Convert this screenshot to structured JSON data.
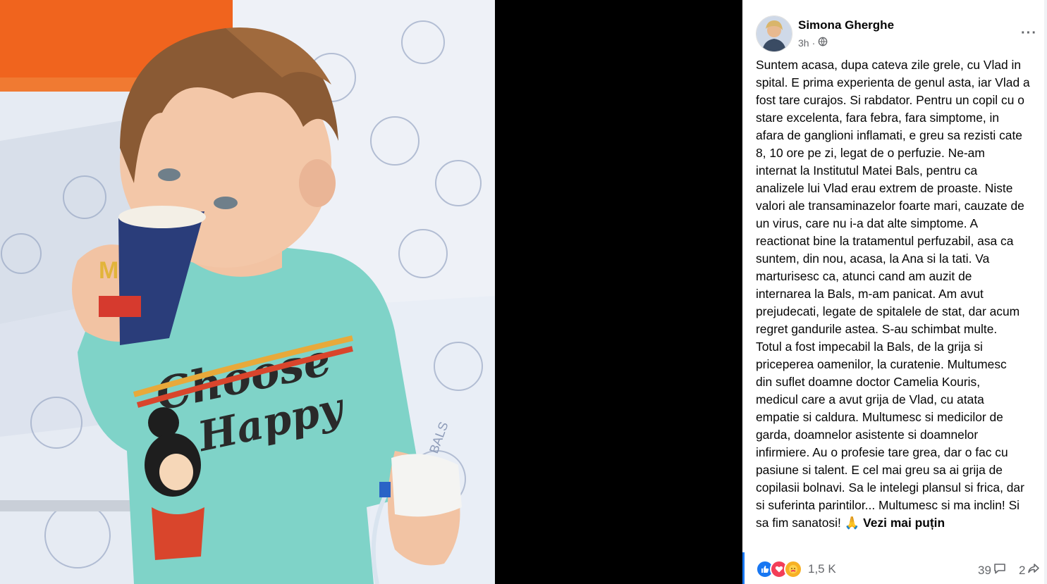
{
  "post": {
    "author": "Simona Gherghe",
    "time": "3h",
    "privacy_icon": "globe-icon",
    "more_label": "···",
    "lines": [
      "Suntem acasa, dupa cateva zile grele, cu Vlad in",
      "spital. E prima experienta de genul asta, iar Vlad a",
      "fost tare curajos. Si rabdator. Pentru un copil cu o",
      "stare excelenta, fara febra, fara simptome, in",
      "afara de ganglioni inflamati, e greu sa rezisti cate",
      "8, 10 ore pe zi, legat de o perfuzie. Ne-am",
      "internat la Institutul Matei Bals, pentru ca",
      "analizele lui Vlad erau extrem de proaste. Niste",
      "valori ale transaminazelor foarte mari, cauzate de",
      "un virus, care nu i-a dat alte simptome. A",
      "reactionat bine la tratamentul perfuzabil, asa ca",
      "suntem, din nou, acasa, la Ana si la tati. Va",
      "marturisesc ca, atunci cand am auzit de",
      "internarea la Bals, m-am panicat. Am avut",
      "prejudecati, legate de spitalele de stat, dar acum",
      "regret gandurile astea. S-au schimbat multe.",
      "Totul a fost impecabil la Bals, de la grija si",
      "priceperea oamenilor, la curatenie. Multumesc",
      "din suflet doamne doctor Camelia Kouris,",
      "medicul care a avut grija de Vlad, cu atata",
      "empatie si caldura. Multumesc si medicilor de",
      "garda, doamnelor asistente si doamnelor",
      "infirmiere. Au o profesie tare grea, dar o fac cu",
      "pasiune si talent. E cel mai greu sa ai grija de",
      "copilasii bolnavi. Sa le intelegi plansul si frica, dar",
      "si suferinta parintilor... Multumesc si ma inclin! Si"
    ],
    "last_line": "sa fim sanatosi! ",
    "emoji": "🙏",
    "see_less": "Vezi mai puțin",
    "reaction_count": "1,5 K",
    "comment_count": "39",
    "share_count": "2",
    "colors": {
      "accent": "#1877f2",
      "muted": "#65676b",
      "text": "#050505"
    }
  },
  "photo": {
    "shirt_text_1": "Choose",
    "shirt_text_2": "Happy",
    "pillow_text": "MATEI BALS",
    "cup_logo": "M"
  }
}
